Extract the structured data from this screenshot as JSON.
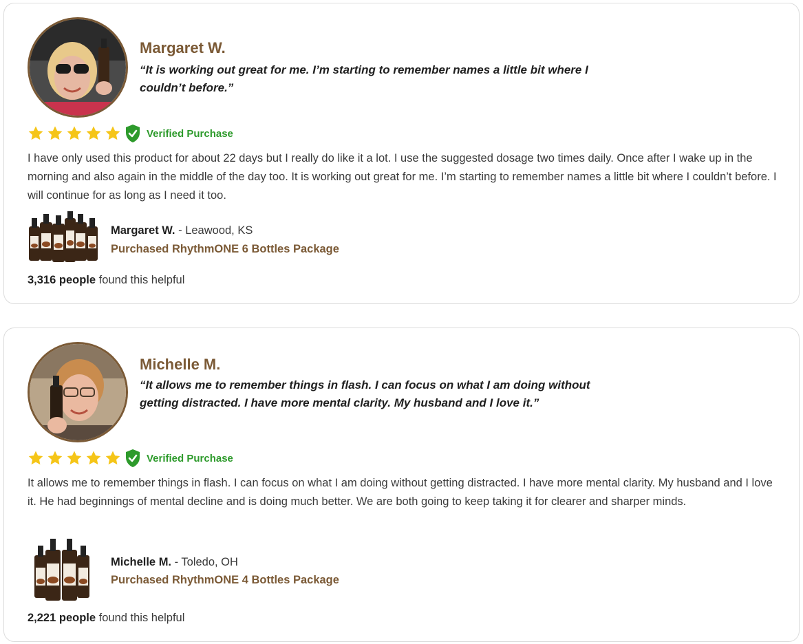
{
  "colors": {
    "accent_brown": "#7b5a36",
    "star_yellow": "#f5c518",
    "verified_green": "#2d9a2b",
    "card_border": "#dcdcdc"
  },
  "rating_max": 5,
  "reviews": [
    {
      "reviewer": "Margaret W.",
      "headline_quote": "“It is working out great for me. I’m starting to remember names a little bit where I couldn’t before.”",
      "stars": 5,
      "badge_icon": "shield-check-icon",
      "verified_label": "Verified Purchase",
      "body": "I have only used this product for about 22 days but I really do like it a lot. I use the suggested dosage two times daily. Once after I wake up in the morning and also again in the middle of the day too. It is working out great for me. I’m starting to remember names a little bit where I couldn’t before. I will continue for as long as I need it too.",
      "buyer_name": "Margaret W.",
      "location": " - Leawood, KS",
      "package": "Purchased RhythmONE 6 Bottles Package",
      "bottle_count": 6,
      "helpful_count": "3,316 people",
      "helpful_suffix": " found this helpful"
    },
    {
      "reviewer": "Michelle M.",
      "headline_quote": "“It allows me to remember things in flash. I can focus on what I am doing without getting distracted. I have more mental clarity. My husband and I love it.”",
      "stars": 5,
      "badge_icon": "shield-check-icon",
      "verified_label": "Verified Purchase",
      "body": "It allows me to remember things in flash. I can focus on what I am doing without getting distracted. I have more mental clarity. My husband and I love it. He had beginnings of mental decline and is doing much better. We are both going to keep taking it for clearer and sharper minds.",
      "buyer_name": "Michelle M.",
      "location": " - Toledo, OH",
      "package": "Purchased RhythmONE 4 Bottles Package",
      "bottle_count": 4,
      "helpful_count": "2,221 people",
      "helpful_suffix": " found this helpful"
    }
  ]
}
